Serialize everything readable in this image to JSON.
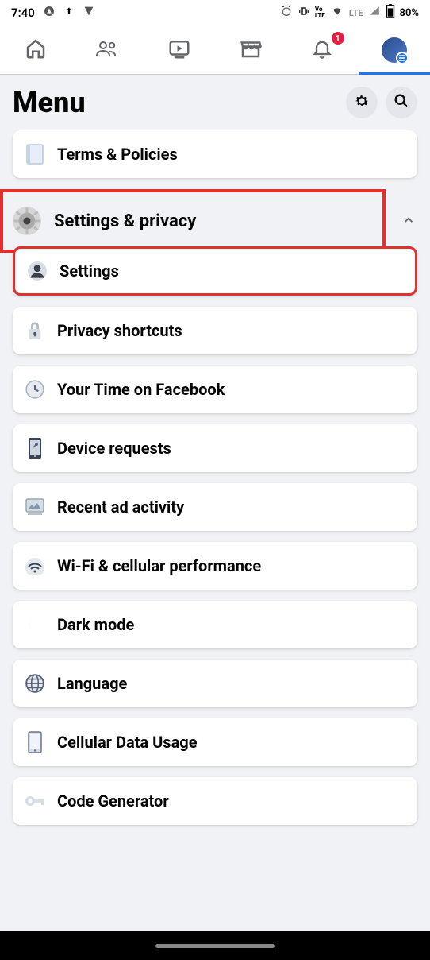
{
  "status": {
    "time": "7:40",
    "battery": "80%",
    "network_type": "LTE",
    "volte_label": "Vo LTE"
  },
  "tabs": {
    "notif_count": "1"
  },
  "header": {
    "title": "Menu"
  },
  "top_card": {
    "label": "Terms & Policies"
  },
  "section": {
    "title": "Settings & privacy"
  },
  "items": [
    {
      "label": "Settings"
    },
    {
      "label": "Privacy shortcuts"
    },
    {
      "label": "Your Time on Facebook"
    },
    {
      "label": "Device requests"
    },
    {
      "label": "Recent ad activity"
    },
    {
      "label": "Wi-Fi & cellular performance"
    },
    {
      "label": "Dark mode"
    },
    {
      "label": "Language"
    },
    {
      "label": "Cellular Data Usage"
    },
    {
      "label": "Code Generator"
    }
  ]
}
